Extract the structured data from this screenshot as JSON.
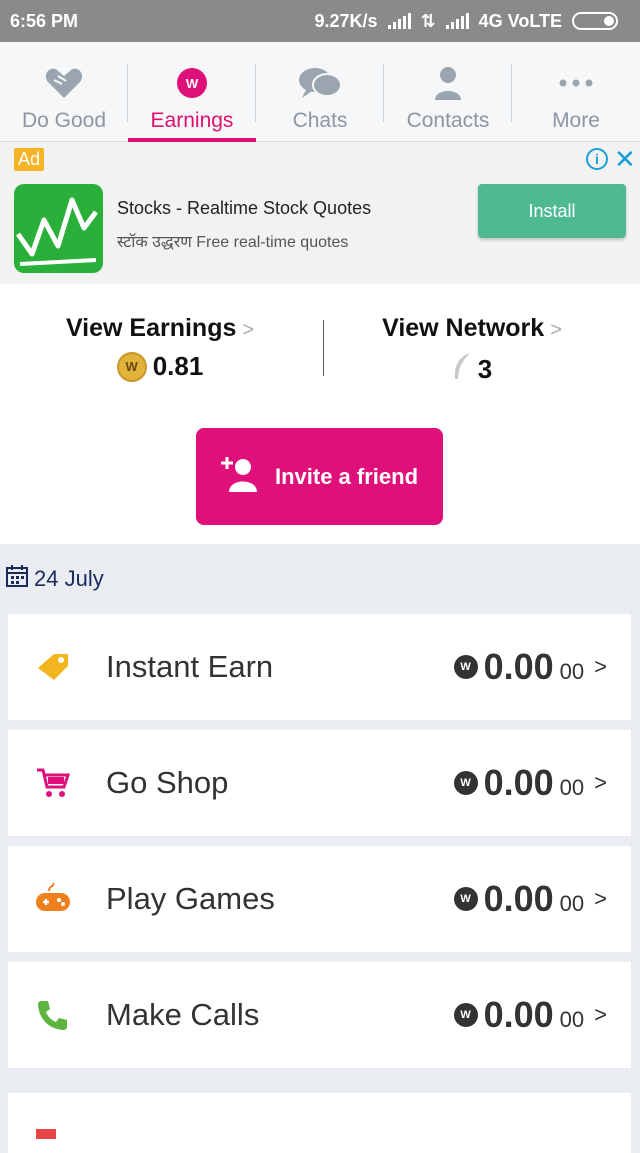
{
  "status_bar": {
    "time": "6:56 PM",
    "speed": "9.27K/s",
    "network": "4G VoLTE"
  },
  "tabs": [
    {
      "label": "Do Good",
      "icon": "heart-hands-icon",
      "active": false
    },
    {
      "label": "Earnings",
      "icon": "w-coin-icon",
      "active": true
    },
    {
      "label": "Chats",
      "icon": "chat-bubbles-icon",
      "active": false
    },
    {
      "label": "Contacts",
      "icon": "person-icon",
      "active": false
    },
    {
      "label": "More",
      "icon": "more-dots-icon",
      "active": false
    }
  ],
  "ad": {
    "badge": "Ad",
    "title": "Stocks - Realtime Stock Quotes",
    "subtitle": "स्टॉक उद्धरण Free real-time quotes",
    "install_label": "Install"
  },
  "summary": {
    "earnings_label": "View Earnings",
    "earnings_value": "0.81",
    "network_label": "View Network",
    "network_value": "3",
    "invite_label": "Invite a friend"
  },
  "date": "24 July",
  "items": [
    {
      "label": "Instant Earn",
      "amount": "0.00",
      "decimals": "00",
      "icon": "tag-icon",
      "color": "#f3b51d"
    },
    {
      "label": "Go Shop",
      "amount": "0.00",
      "decimals": "00",
      "icon": "cart-icon",
      "color": "#e0107a"
    },
    {
      "label": "Play Games",
      "amount": "0.00",
      "decimals": "00",
      "icon": "gamepad-icon",
      "color": "#f07f1e"
    },
    {
      "label": "Make Calls",
      "amount": "0.00",
      "decimals": "00",
      "icon": "phone-icon",
      "color": "#5db43e"
    }
  ],
  "colors": {
    "accent": "#e0107a",
    "install": "#4dba92",
    "status_bar": "#8a8a8a"
  }
}
